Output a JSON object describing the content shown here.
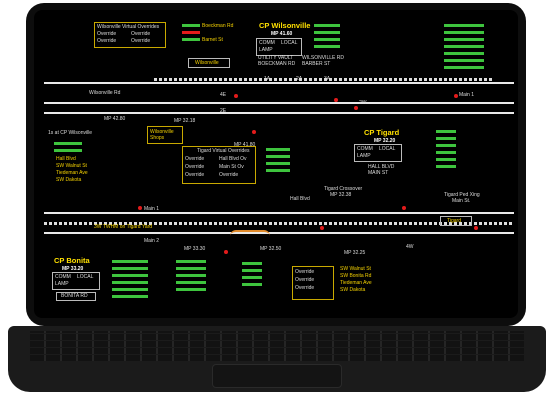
{
  "cp_wilsonville": {
    "title": "CP Wilsonville",
    "mp": "MP 41.60",
    "vault_label": "UTILITY VAULT",
    "boeckman_label": "BOECKMAN RD",
    "wilsonville_rd_label": "WILSONVILLE RD",
    "barber_label": "BARBER ST",
    "comm": "COMM",
    "local": "LOCAL",
    "lamp": "LAMP",
    "vlc": "VLC",
    "station": "Wilsonville",
    "override_header": "Wilsonville Virtual Overrides"
  },
  "cp_tigard": {
    "title": "CP Tigard",
    "mp": "MP 32.20",
    "hall_blvd": "HALL BLVD",
    "main_st": "MAIN ST",
    "comm": "COMM",
    "local": "LOCAL",
    "lamp": "LAMP",
    "vlc": "VLC",
    "override_header": "Tigard Virtual Overrides"
  },
  "cp_bonita": {
    "title": "CP Bonita",
    "mp": "MP 33.20",
    "bonita_rd": "BONITA RD",
    "comm": "COMM",
    "local": "LOCAL",
    "lamp": "LAMP",
    "vlc": "VLC"
  },
  "shops_label": "Wilsonville Shops",
  "tigard_label": "Tigard",
  "wilsonville_mp": "MP 41.80",
  "tigard_crossover": "Tigard Crossover",
  "tigard_crossover_mp": "MP 32.38",
  "hall_blvd": "Hall Blvd",
  "tigard_ped": "Tigard Ped Xing",
  "main_st": "Main St.",
  "main_1": "Main 1",
  "main_2": "Main 2",
  "boeckman_rd": "Boeckman Rd",
  "barnet_st": "Barnet St",
  "wilsonville_rd": "Wilsonville Rd",
  "mp_4280": "MP 42.80",
  "mp_3225": "MP 32.25",
  "mp_3330": "MP 33.30",
  "mp_3218": "MP 32.18",
  "mp_3250": "MP 32.50",
  "tracks": {
    "t1": "1A",
    "t2": "2A",
    "t3": "3A"
  },
  "tiedeman_ave": "Tiedeman Ave",
  "sw_walnut": "SW Walnut St",
  "sw_bonita": "SW Bonita Rd",
  "sw_dakota": "SW Dakota",
  "left_label": "1s at CP Wilsonville",
  "yard_label": "3W TWHM on Tigard Yard",
  "pacific_label": "Pacific Hwy",
  "tualatin_label": "SW Tualatin",
  "override": "Override",
  "hall_blvd_ov": "Hall Blvd Ov",
  "main_st_ov": "Main St Ov",
  "signals": {
    "s1": "2W",
    "s2": "2E",
    "s3": "4E",
    "s4": "4W",
    "s5": "6W",
    "s6": "6E",
    "s7": "8W",
    "s8": "10E"
  },
  "misc_vals": [
    "AAR",
    "20",
    "18",
    "30",
    "44",
    "42",
    "16"
  ]
}
